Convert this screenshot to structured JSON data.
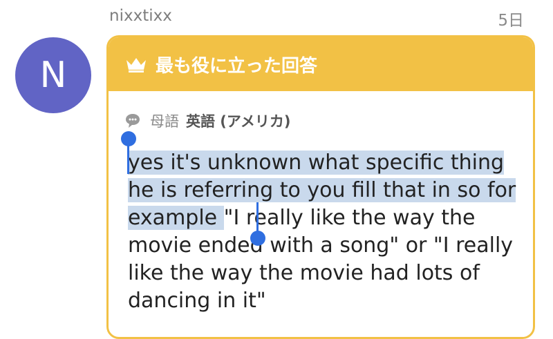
{
  "post": {
    "username": "nixxtixx",
    "timestamp": "5日",
    "avatar_initial": "N"
  },
  "best_answer": {
    "badge_label": "最も役に立った回答",
    "native_label": "母語",
    "native_value": "英語 (アメリカ)",
    "answer_text_selected": "yes it's unknown what specific thing he is referring to you fill that in so for example ",
    "answer_text_rest": "\"I really like the way the movie ended with a song\" or \"I really like the way the movie had lots of dancing in it\""
  },
  "colors": {
    "accent": "#f2c145",
    "avatar_bg": "#6164c5",
    "selection": "#c9d9ec",
    "handle": "#2f6ee0"
  },
  "icons": {
    "crown": "crown-icon",
    "bubble": "speech-bubble-icon"
  }
}
